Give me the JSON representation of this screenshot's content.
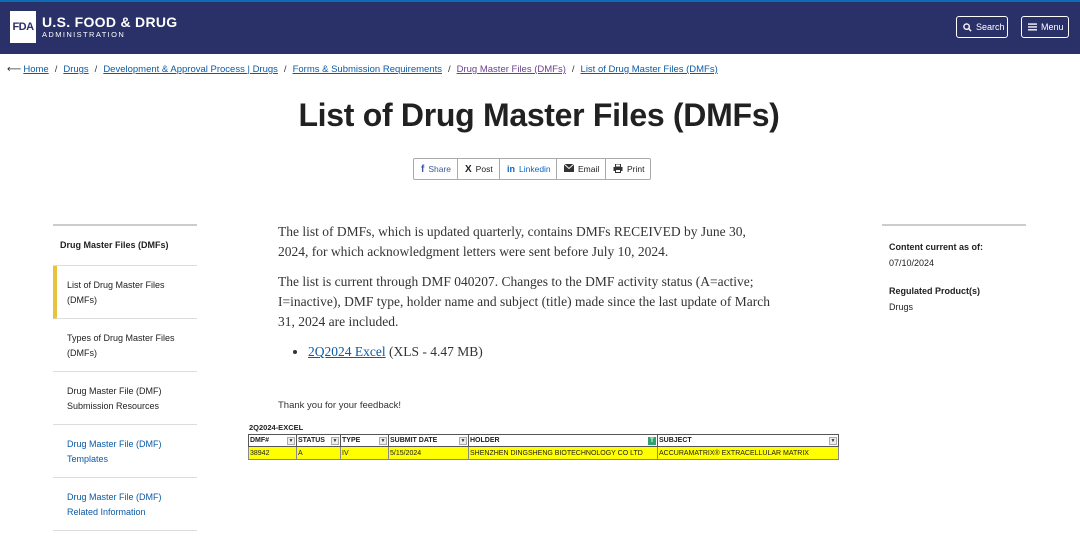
{
  "header": {
    "logo_mark": "FDA",
    "logo_line1": "U.S. FOOD & DRUG",
    "logo_line2": "ADMINISTRATION",
    "search_label": "Search",
    "menu_label": "Menu"
  },
  "breadcrumb": [
    {
      "label": "Home"
    },
    {
      "label": "Drugs"
    },
    {
      "label": "Development & Approval Process | Drugs"
    },
    {
      "label": "Forms & Submission Requirements"
    },
    {
      "label": "Drug Master Files (DMFs)"
    },
    {
      "label": "List of Drug Master Files (DMFs)"
    }
  ],
  "page_title": "List of Drug Master Files (DMFs)",
  "share": {
    "share": "Share",
    "post": "Post",
    "linkedin": "Linkedin",
    "email": "Email",
    "print": "Print"
  },
  "sidebar": {
    "heading": "Drug Master Files (DMFs)",
    "items": [
      {
        "label": "List of Drug Master Files (DMFs)"
      },
      {
        "label": "Types of Drug Master Files (DMFs)"
      },
      {
        "label": "Drug Master File (DMF) Submission Resources"
      },
      {
        "label": "Drug Master File (DMF) Templates"
      },
      {
        "label": "Drug Master File (DMF) Related Information"
      }
    ]
  },
  "content": {
    "para1": "The list of DMFs, which is updated quarterly, contains DMFs RECEIVED by June 30, 2024, for which acknowledgment letters were sent before July 10, 2024.",
    "para2": "The list is current through DMF 040207. Changes to the DMF activity status (A=active; I=inactive), DMF type, holder name and subject (title) made since the last update of March 31, 2024 are included.",
    "download_link": "2Q2024 Excel",
    "download_meta": " (XLS - 4.47 MB)",
    "feedback": "Thank you for your feedback!"
  },
  "rightbar": {
    "content_current_label": "Content current as of:",
    "content_current_value": "07/10/2024",
    "regulated_label": "Regulated Product(s)",
    "regulated_value": "Drugs"
  },
  "excel": {
    "title": "2Q2024-EXCEL",
    "headers": [
      "DMF#",
      "STATUS",
      "TYPE",
      "SUBMIT DATE",
      "HOLDER",
      "SUBJECT"
    ],
    "row": [
      "38942",
      "A",
      "IV",
      "5/15/2024",
      "SHENZHEN DINGSHENG BIOTECHNOLOGY CO LTD",
      "ACCURAMATRIX® EXTRACELLULAR MATRIX"
    ]
  },
  "colors": {
    "header_bg": "#2a3169",
    "link": "#0b5aa5",
    "active_marker": "#e8c33f",
    "excel_highlight": "#ffff00"
  }
}
